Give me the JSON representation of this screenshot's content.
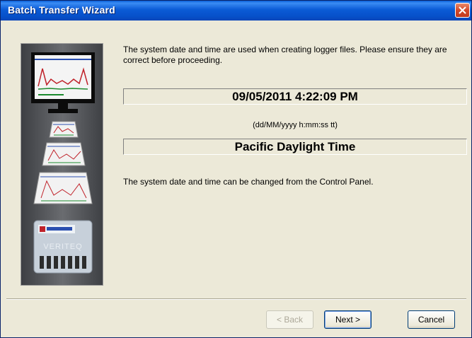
{
  "window": {
    "title": "Batch Transfer Wizard",
    "close_icon": "close-icon"
  },
  "content": {
    "description": "The system date and time are used when creating logger files. Please ensure they are correct before proceeding.",
    "datetime": "09/05/2011 4:22:09 PM",
    "format_hint": "(dd/MM/yyyy h:mm:ss tt)",
    "timezone": "Pacific Daylight Time",
    "change_note": "The system date and time can be changed from the Control Panel."
  },
  "buttons": {
    "back": "< Back",
    "next": "Next >",
    "cancel": "Cancel"
  },
  "sidebar_image": {
    "device_label": "VERITEQ"
  }
}
